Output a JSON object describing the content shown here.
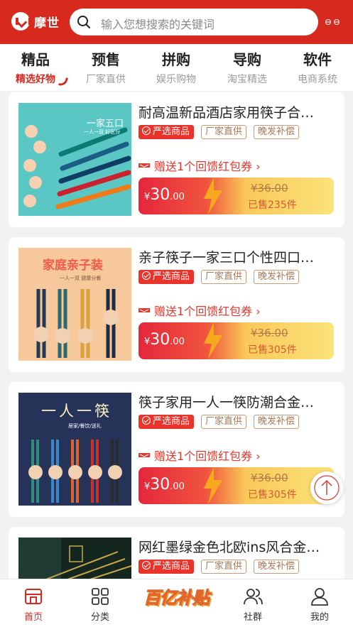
{
  "app": {
    "name": "摩世",
    "search_placeholder": "输入您想搜索的关键词"
  },
  "tabs": [
    {
      "title": "精品",
      "sub": "精选好物",
      "active": true
    },
    {
      "title": "预售",
      "sub": "厂家直供",
      "active": false
    },
    {
      "title": "拼购",
      "sub": "娱乐购物",
      "active": false
    },
    {
      "title": "导购",
      "sub": "淘宝精选",
      "active": false
    },
    {
      "title": "软件",
      "sub": "电商系统",
      "active": false
    }
  ],
  "products": [
    {
      "title": "耐高温新品酒店家用筷子合…",
      "tags": [
        "严选商品",
        "厂家直供",
        "晚发补偿"
      ],
      "coupon": "赠送1个回馈红包券 ›",
      "price_symbol": "¥",
      "price_int": "30",
      "price_dec": ".00",
      "original_price": "¥36.00",
      "sold": "已售235件",
      "thumb_label": "一家五口",
      "thumb_sub": "一人一双 好区分"
    },
    {
      "title": "亲子筷子一家三口个性四口…",
      "tags": [
        "严选商品",
        "厂家直供",
        "晚发补偿"
      ],
      "coupon": "赠送1个回馈红包券 ›",
      "price_symbol": "¥",
      "price_int": "30",
      "price_dec": ".00",
      "original_price": "¥36.00",
      "sold": "已售305件",
      "thumb_label": "家庭亲子装",
      "thumb_sub": "一人一双 健康分餐"
    },
    {
      "title": "筷子家用一人一筷防潮合金…",
      "tags": [
        "严选商品",
        "厂家直供",
        "晚发补偿"
      ],
      "coupon": "赠送1个回馈红包券 ›",
      "price_symbol": "¥",
      "price_int": "30",
      "price_dec": ".00",
      "original_price": "¥36.00",
      "sold": "已售305件",
      "thumb_label": "一人一筷",
      "thumb_sub": "居家/餐饮/送礼"
    },
    {
      "title": "网红墨绿金色北欧ins风合金…",
      "tags": [
        "严选商品",
        "厂家直供",
        "晚发补偿"
      ]
    }
  ],
  "bottom_nav": [
    {
      "label": "首页",
      "icon": "home-icon",
      "active": true
    },
    {
      "label": "分类",
      "icon": "grid-icon",
      "active": false
    },
    {
      "label": "社群",
      "icon": "community-icon",
      "active": false
    },
    {
      "label": "我的",
      "icon": "user-icon",
      "active": false
    }
  ],
  "promo": {
    "label": "百亿补贴"
  },
  "colors": {
    "brand": "#d8291f",
    "price_gradient_start": "#e5263c",
    "price_gradient_end": "#fbe37a"
  }
}
